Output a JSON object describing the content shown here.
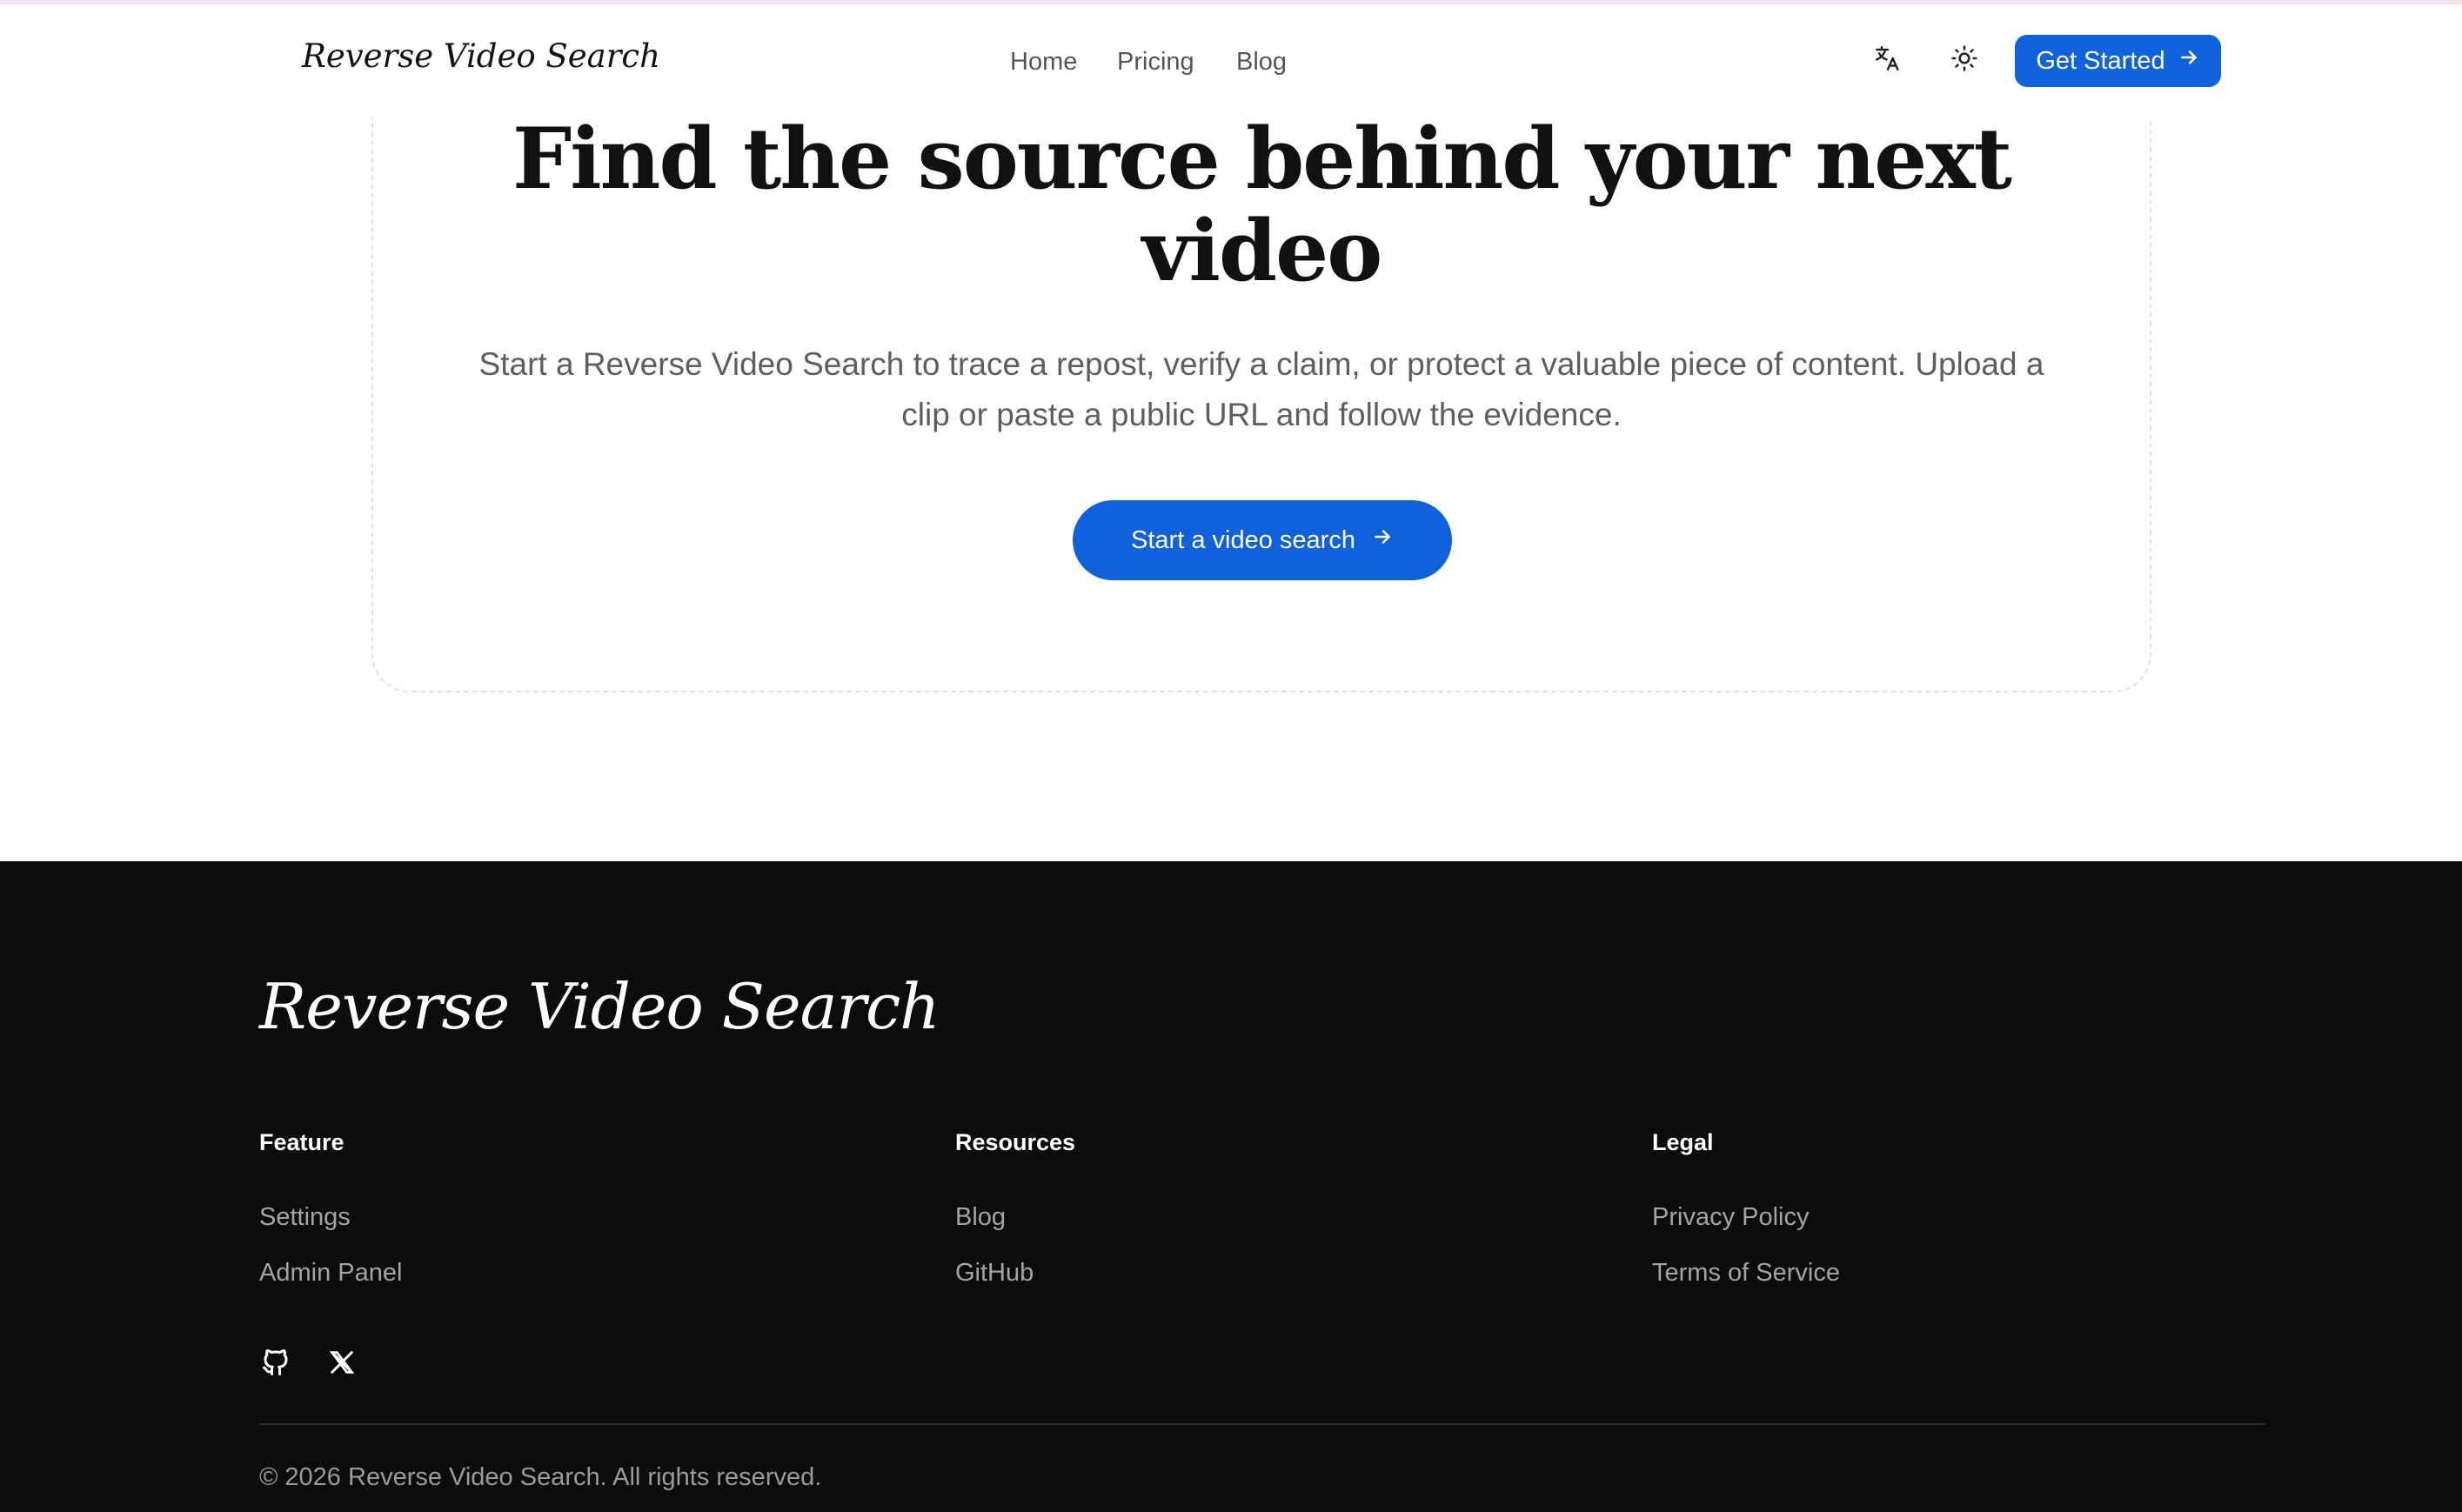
{
  "header": {
    "brand": "Reverse Video Search",
    "nav": [
      {
        "label": "Home"
      },
      {
        "label": "Pricing"
      },
      {
        "label": "Blog"
      }
    ],
    "translate_icon": "translate-icon",
    "theme_icon": "sun-icon",
    "cta_label": "Get Started",
    "accent_color": "#0f62dc"
  },
  "hero": {
    "title": "Find the source behind your next video",
    "subtitle": "Start a Reverse Video Search to trace a repost, verify a claim, or protect a valuable piece of content. Upload a clip or paste a public URL and follow the evidence.",
    "cta_label": "Start a video search"
  },
  "footer": {
    "brand": "Reverse Video Search",
    "columns": [
      {
        "title": "Feature",
        "links": [
          "Settings",
          "Admin Panel"
        ]
      },
      {
        "title": "Resources",
        "links": [
          "Blog",
          "GitHub"
        ]
      },
      {
        "title": "Legal",
        "links": [
          "Privacy Policy",
          "Terms of Service"
        ]
      }
    ],
    "social_icons": [
      "github-icon",
      "x-icon"
    ],
    "copyright": "© 2026 Reverse Video Search. All rights reserved."
  }
}
